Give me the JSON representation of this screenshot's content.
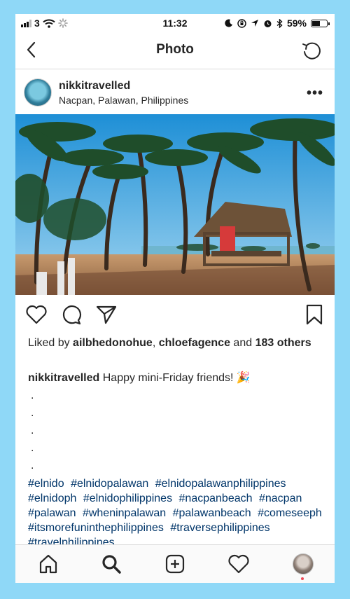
{
  "status_bar": {
    "carrier": "3",
    "time": "11:32",
    "battery": "59%",
    "battery_level": 0.59
  },
  "nav": {
    "title": "Photo"
  },
  "post": {
    "username": "nikkitravelled",
    "location": "Nacpan, Palawan, Philippines",
    "likes": {
      "prefix": "Liked by ",
      "user1": "ailbhedonohue",
      "sep": ", ",
      "user2": "chloefagence",
      "mid": " and ",
      "count": "183 others"
    },
    "caption": {
      "username": "nikkitravelled",
      "text": "Happy mini-Friday friends! 🎉"
    },
    "dots": [
      ".",
      ".",
      ".",
      ".",
      "."
    ],
    "hashtags": [
      "#elnido",
      "#elnidopalawan",
      "#elnidopalawanphilippines",
      "#elnidoph",
      "#elnidophilippines",
      "#nacpanbeach",
      "#nacpan",
      "#palawan",
      "#wheninpalawan",
      "#palawanbeach",
      "#comeseeph",
      "#itsmorefuninthephilippines",
      "#traversephilippines",
      "#travelphilippines"
    ]
  },
  "colors": {
    "background": "#8fd8f7",
    "hashtag": "#003569",
    "notification": "#ed4956"
  }
}
